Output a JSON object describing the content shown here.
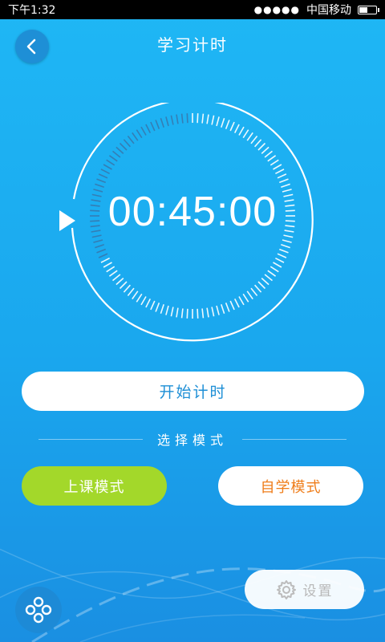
{
  "status_bar": {
    "time": "下午1:32",
    "signal": "●●●●●",
    "carrier": "中国移动",
    "battery_level": 0.55
  },
  "header": {
    "title": "学习计时",
    "back_icon": "chevron-left-icon"
  },
  "timer": {
    "display": "00:45:00",
    "play_icon": "play-triangle-icon"
  },
  "start_button": {
    "label": "开始计时"
  },
  "mode_section": {
    "label": "选择模式",
    "class_mode": {
      "label": "上课模式",
      "color": "#a3d82a"
    },
    "self_mode": {
      "label": "自学模式",
      "color": "#ef7d1a"
    }
  },
  "settings_button": {
    "label": "设置",
    "icon": "gear-icon"
  },
  "menu_button": {
    "icon": "four-circles-icon"
  },
  "colors": {
    "background": "#1fb7f5",
    "accent_dark": "#1e8fd6"
  }
}
